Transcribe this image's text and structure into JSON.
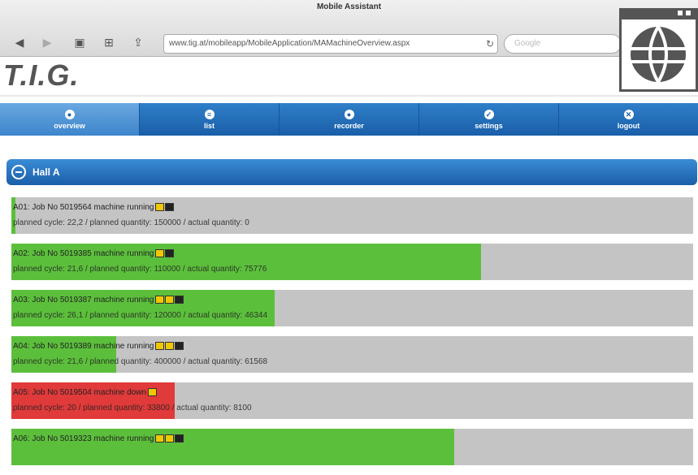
{
  "browser": {
    "title": "Mobile Assistant",
    "url": "www.tig.at/mobileapp/MobileApplication/MAMachineOverview.aspx",
    "search_placeholder": "Google",
    "back_icon": "back-arrow-icon",
    "forward_icon": "forward-arrow-icon"
  },
  "logo": {
    "text": "T.I.G."
  },
  "nav": {
    "items": [
      {
        "label": "overview",
        "icon": "overview-icon",
        "active": true
      },
      {
        "label": "list",
        "icon": "list-icon"
      },
      {
        "label": "recorder",
        "icon": "recorder-icon"
      },
      {
        "label": "settings",
        "icon": "settings-icon"
      },
      {
        "label": "logout",
        "icon": "logout-icon"
      }
    ]
  },
  "section": {
    "title": "Hall A"
  },
  "machines": [
    {
      "line1": "A01: Job No 5019564 machine running",
      "line2": "planned cycle: 22,2 / planned quantity: 150000 / actual quantity: 0",
      "progress": 0.0,
      "color": "#5cbf3c"
    },
    {
      "line1": "A02: Job No 5019385 machine running",
      "line2": "planned cycle: 21,6 / planned quantity: 110000 / actual quantity: 75776",
      "progress": 0.689,
      "color": "#5cbf3c"
    },
    {
      "line1": "A03: Job No 5019387 machine running",
      "line2": "planned cycle: 26,1 / planned quantity: 120000 / actual quantity: 46344",
      "progress": 0.386,
      "color": "#5cbf3c"
    },
    {
      "line1": "A04: Job No 5019389 machine running",
      "line2": "planned cycle: 21,6 / planned quantity: 400000 / actual quantity: 61568",
      "progress": 0.154,
      "color": "#5cbf3c"
    },
    {
      "line1": "A05: Job No 5019504 machine down",
      "line2": "planned cycle: 20 / planned quantity: 33800 / actual quantity: 8100",
      "progress": 0.24,
      "color": "#e03a3a"
    },
    {
      "line1": "A06: Job No 5019323 machine running",
      "line2": "",
      "progress": 0.65,
      "color": "#5cbf3c"
    }
  ]
}
